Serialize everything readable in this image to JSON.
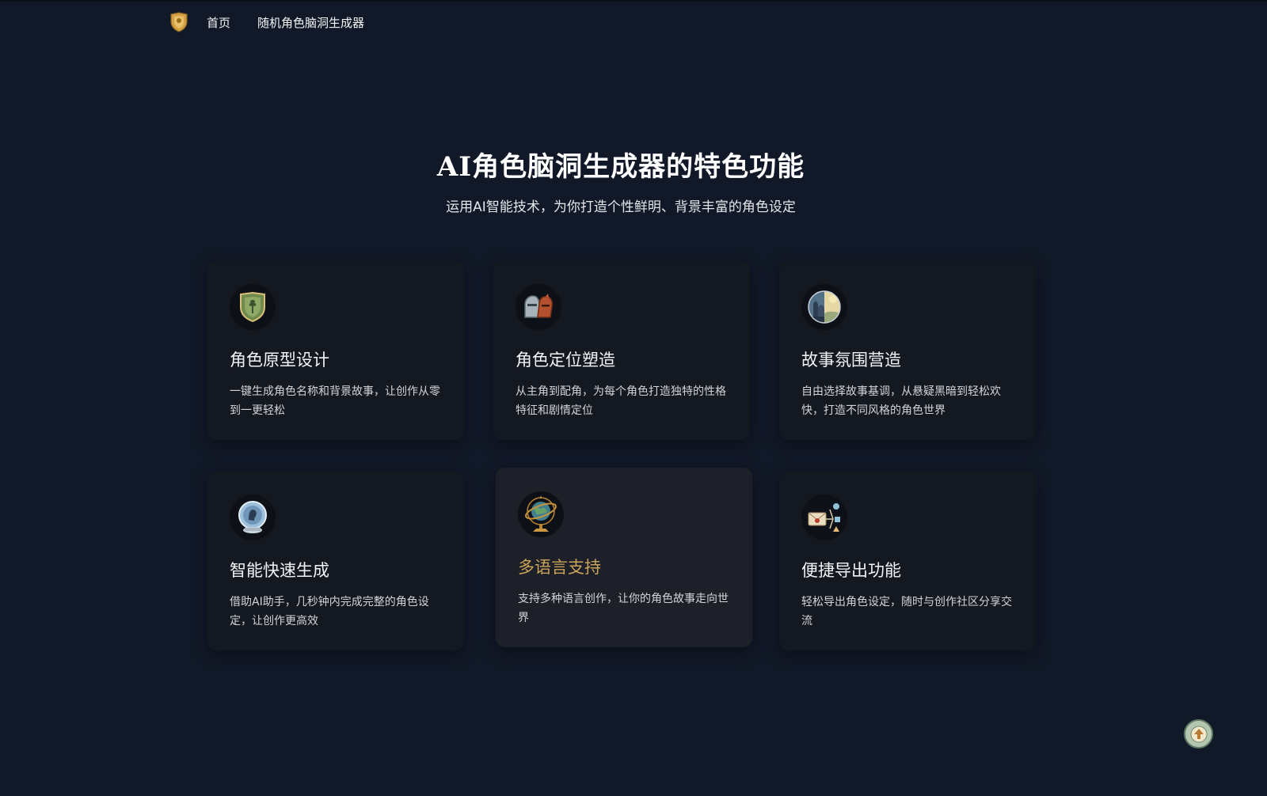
{
  "nav": {
    "logo_icon": "shield-logo-icon",
    "links": [
      "首页",
      "随机角色脑洞生成器"
    ]
  },
  "hero": {
    "title": "AI角色脑洞生成器的特色功能",
    "subtitle": "运用AI智能技术，为你打造个性鲜明、背景丰富的角色设定"
  },
  "features": [
    {
      "icon": "shield-emblem-icon",
      "title": "角色原型设计",
      "desc": "一键生成角色名称和背景故事，让创作从零到一更轻松"
    },
    {
      "icon": "knight-helmets-icon",
      "title": "角色定位塑造",
      "desc": "从主角到配角，为每个角色打造独特的性格特征和剧情定位"
    },
    {
      "icon": "castle-landscape-icon",
      "title": "故事氛围营造",
      "desc": "自由选择故事基调，从悬疑黑暗到轻松欢快，打造不同风格的角色世界"
    },
    {
      "icon": "crystal-ball-icon",
      "title": "智能快速生成",
      "desc": "借助AI助手，几秒钟内完成完整的角色设定，让创作更高效"
    },
    {
      "icon": "armillary-globe-icon",
      "title": "多语言支持",
      "desc": "支持多种语言创作，让你的角色故事走向世界"
    },
    {
      "icon": "export-share-icon",
      "title": "便捷导出功能",
      "desc": "轻松导出角色设定，随时与创作社区分享交流"
    }
  ],
  "colors": {
    "background": "#111827",
    "card": "#141820",
    "accent": "#c9a45a"
  },
  "back_to_top_icon": "arrow-up-icon"
}
